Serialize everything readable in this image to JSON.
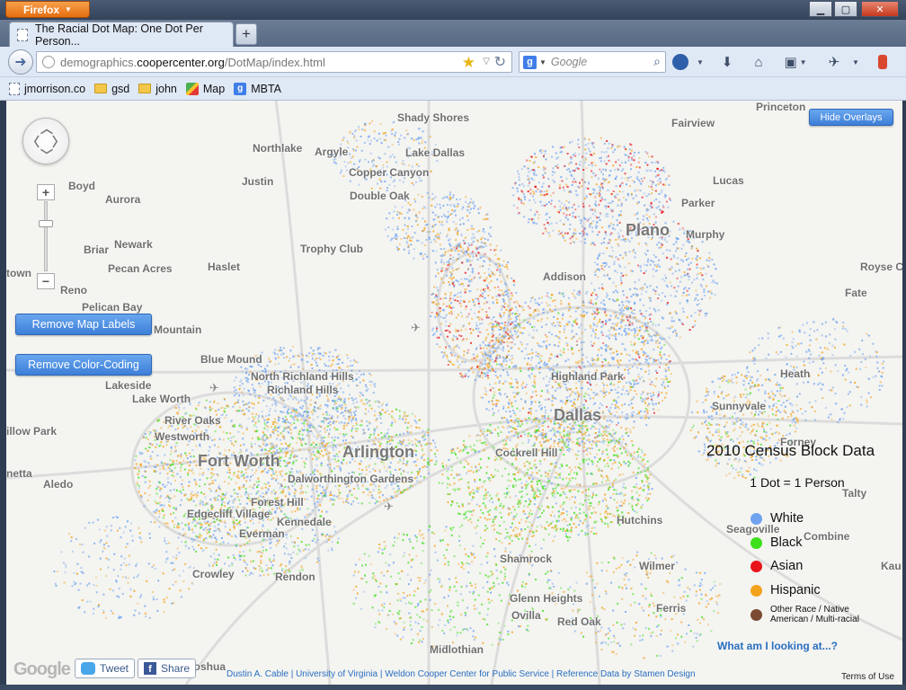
{
  "browser": {
    "app_button": "Firefox",
    "tab_title": "The Racial Dot Map: One Dot Per Person...",
    "url_prefix": "demographics.",
    "url_host": "coopercenter.org",
    "url_path": "/DotMap/index.html",
    "search_engine": "g",
    "search_placeholder": "Google",
    "bookmarks": [
      {
        "label": "jmorrison.co",
        "icon": "page-icon"
      },
      {
        "label": "gsd",
        "icon": "folder-icon"
      },
      {
        "label": "john",
        "icon": "folder-icon"
      },
      {
        "label": "Map",
        "icon": "map-icon"
      },
      {
        "label": "MBTA",
        "icon": "google-icon"
      }
    ]
  },
  "map": {
    "buttons": {
      "hide_overlays": "Hide Overlays",
      "remove_labels": "Remove Map Labels",
      "remove_color": "Remove Color-Coding"
    },
    "places": [
      "Shady Shores",
      "Fairview",
      "Princeton",
      "Northlake",
      "Argyle",
      "Lake Dallas",
      "Boyd",
      "Justin",
      "Copper Canyon",
      "Lucas",
      "Aurora",
      "Double Oak",
      "Parker",
      "Plano",
      "Murphy",
      "Briar",
      "Newark",
      "Trophy Club",
      "Pecan Acres",
      "Haslet",
      "Royse C",
      "Addison",
      "Reno",
      "Fate",
      "Pelican Bay",
      "Mountain",
      "Blue Mound",
      "North Richland Hills",
      "Highland Park",
      "Heath",
      "Richland Hills",
      "Lakeside",
      "Lake Worth",
      "Sunnyvale",
      "Dallas",
      "River Oaks",
      "Westworth",
      "Arlington",
      "Fort Worth",
      "Cockrell Hill",
      "Forney",
      "Dalworthington Gardens",
      "Aledo",
      "Forest Hill",
      "Edgecliff Village",
      "Kennedale",
      "Talty",
      "Hutchins",
      "Everman",
      "Seagoville",
      "Combine",
      "Shamrock",
      "Wilmer",
      "Crowley",
      "Rendon",
      "Glenn Heights",
      "Ovilla",
      "Ferris",
      "Red Oak",
      "Midlothian",
      "Joshua",
      "town",
      "illow Park",
      "netta",
      "Kau"
    ],
    "legend": {
      "title": "2010 Census Block Data",
      "subtitle": "1 Dot = 1 Person",
      "items": [
        {
          "label": "White",
          "color": "#6fa3f0"
        },
        {
          "label": "Black",
          "color": "#3ee01b"
        },
        {
          "label": "Asian",
          "color": "#e8141a"
        },
        {
          "label": "Hispanic",
          "color": "#f2a31b"
        },
        {
          "label_line1": "Other Race / Native",
          "label_line2": "American / Multi-racial",
          "color": "#7a4a33"
        }
      ]
    },
    "what_link": "What am I looking at...?",
    "tweet": "Tweet",
    "share": "Share",
    "google_logo": "Google",
    "credit": "Dustin A. Cable | University of Virginia | Weldon Cooper Center for Public Service | Reference Data by Stamen Design",
    "terms": "Terms of Use"
  }
}
